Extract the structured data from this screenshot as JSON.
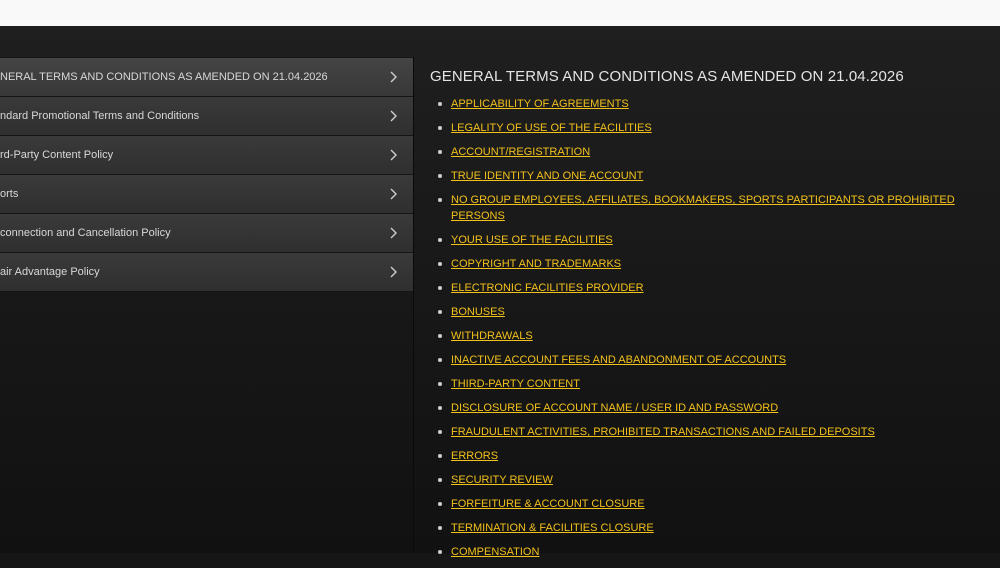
{
  "sidebar": {
    "items": [
      {
        "label": "NERAL TERMS AND CONDITIONS AS AMENDED ON 21.04.2026",
        "active": true
      },
      {
        "label": "ndard Promotional Terms and Conditions",
        "active": false
      },
      {
        "label": "rd-Party Content Policy",
        "active": false
      },
      {
        "label": "orts",
        "active": false
      },
      {
        "label": "connection and Cancellation Policy",
        "active": false
      },
      {
        "label": "air Advantage Policy",
        "active": false
      }
    ]
  },
  "main": {
    "title": "GENERAL TERMS AND CONDITIONS AS AMENDED ON 21.04.2026",
    "links": [
      "APPLICABILITY OF AGREEMENTS",
      "LEGALITY OF USE OF THE FACILITIES",
      "ACCOUNT/REGISTRATION",
      "TRUE IDENTITY AND ONE ACCOUNT",
      "NO GROUP EMPLOYEES, AFFILIATES, BOOKMAKERS, SPORTS PARTICIPANTS OR PROHIBITED PERSONS",
      "YOUR USE OF THE FACILITIES",
      "COPYRIGHT AND TRADEMARKS",
      "ELECTRONIC FACILITIES PROVIDER",
      "BONUSES",
      "WITHDRAWALS",
      "INACTIVE ACCOUNT FEES AND ABANDONMENT OF ACCOUNTS",
      "THIRD-PARTY CONTENT",
      "DISCLOSURE OF ACCOUNT NAME / USER ID AND PASSWORD",
      "FRAUDULENT ACTIVITIES, PROHIBITED TRANSACTIONS AND FAILED DEPOSITS",
      "ERRORS",
      "SECURITY REVIEW",
      "FORFEITURE & ACCOUNT CLOSURE",
      "TERMINATION & FACILITIES CLOSURE",
      "COMPENSATION"
    ]
  },
  "colors": {
    "link": "#f2c11c",
    "background": "#161616",
    "topbar": "#f9f9f9",
    "sidebar_item": "#333333"
  },
  "icons": {
    "sidebar_chevron": "chevron-right-icon"
  }
}
